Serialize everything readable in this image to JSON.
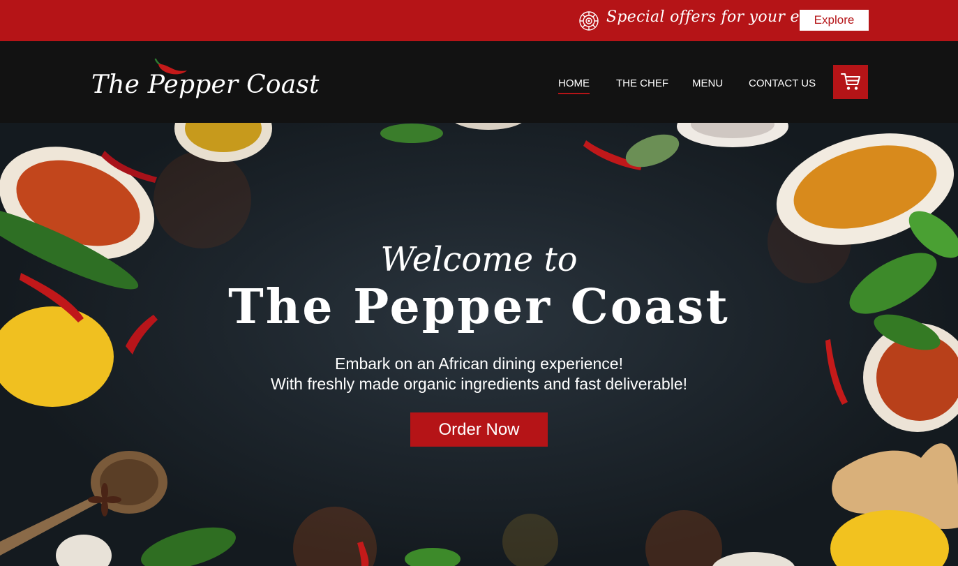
{
  "promo": {
    "text": "Special offers for your events",
    "button_label": "Explore",
    "icon": "mandala-icon"
  },
  "nav": {
    "logo_text": "The Pepper Coast",
    "logo_icon": "chili-pepper-icon",
    "items": [
      {
        "label": "HOME",
        "active": true
      },
      {
        "label": "THE CHEF",
        "active": false
      },
      {
        "label": "MENU",
        "active": false
      },
      {
        "label": "CONTACT US",
        "active": false
      }
    ],
    "cart_icon": "shopping-cart-icon"
  },
  "hero": {
    "welcome": "Welcome to",
    "title": "The Pepper Coast",
    "subtitle_line1": "Embark on an African dining experience!",
    "subtitle_line2": "With freshly made organic ingredients and fast deliverable!",
    "cta_label": "Order Now"
  },
  "colors": {
    "brand_red": "#b51417",
    "header_black": "#121212",
    "hero_background": "#1d252c",
    "text_white": "#ffffff"
  }
}
